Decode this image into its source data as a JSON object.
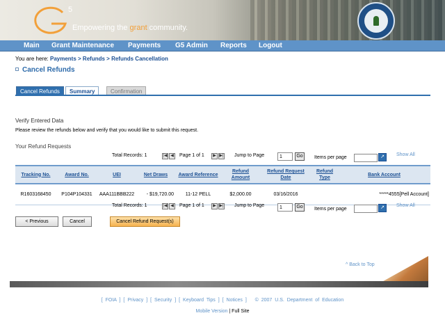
{
  "header": {
    "logo_letter": "G",
    "logo_superscript": "5",
    "tagline_before": "Empowering the ",
    "tagline_accent": "grant",
    "tagline_after": " community."
  },
  "nav": [
    "Main",
    "Grant Maintenance",
    "Payments",
    "G5 Admin",
    "Reports",
    "Logout"
  ],
  "breadcrumb": {
    "prefix": "You are here:",
    "items": [
      "Payments",
      "Refunds",
      "Refunds Cancellation"
    ],
    "separator": ">"
  },
  "page_title": "Cancel Refunds",
  "tabs": [
    "Cancel Refunds",
    "Summary",
    "Confirmation"
  ],
  "verify": {
    "title": "Verify Entered Data",
    "text": "Please review the refunds below and verify that you would like to submit this request."
  },
  "requests_title": "Your Refund Requests",
  "pager": {
    "total_records": "Total Records: 1",
    "page_label": "Page 1 of 1",
    "jump_label": "Jump to Page",
    "page_value": "1",
    "go_label": "Go",
    "items_per_page": "Items per page",
    "show_all": "Show All",
    "first_glyph": "|◀",
    "prev_glyph": "◀",
    "next_glyph": "▶",
    "last_glyph": "▶|",
    "ipp_go_glyph": "↗"
  },
  "table": {
    "headers": [
      "Tracking No.",
      "Award No.",
      "UEI",
      "Net Draws",
      "Award Reference",
      "Refund Amount",
      "Refund Request Date",
      "Refund Type",
      "Bank Account"
    ],
    "rows": [
      [
        "R1603168450",
        "P104P104331",
        "AAA111BBB222",
        "- $19,720.00",
        "11-12 PELL",
        "$2,000.00",
        "03/16/2016",
        "",
        "*****4555[Pell Account]"
      ]
    ]
  },
  "buttons": {
    "previous": "< Previous",
    "cancel": "Cancel",
    "submit": "Cancel Refund Request(s)"
  },
  "back_to_top": "^ Back to Top",
  "footer": {
    "links": [
      "FOIA",
      "Privacy",
      "Security",
      "Keyboard Tips",
      "Notices"
    ],
    "copyright": "© 2007 U.S. Department of Education",
    "mobile": "Mobile Version",
    "full": "Full Site"
  },
  "colors": {
    "nav_bg": "#5f93c8",
    "accent": "#f2a03a",
    "link": "#1b4f93",
    "submit_bg": "#f6b24f"
  }
}
